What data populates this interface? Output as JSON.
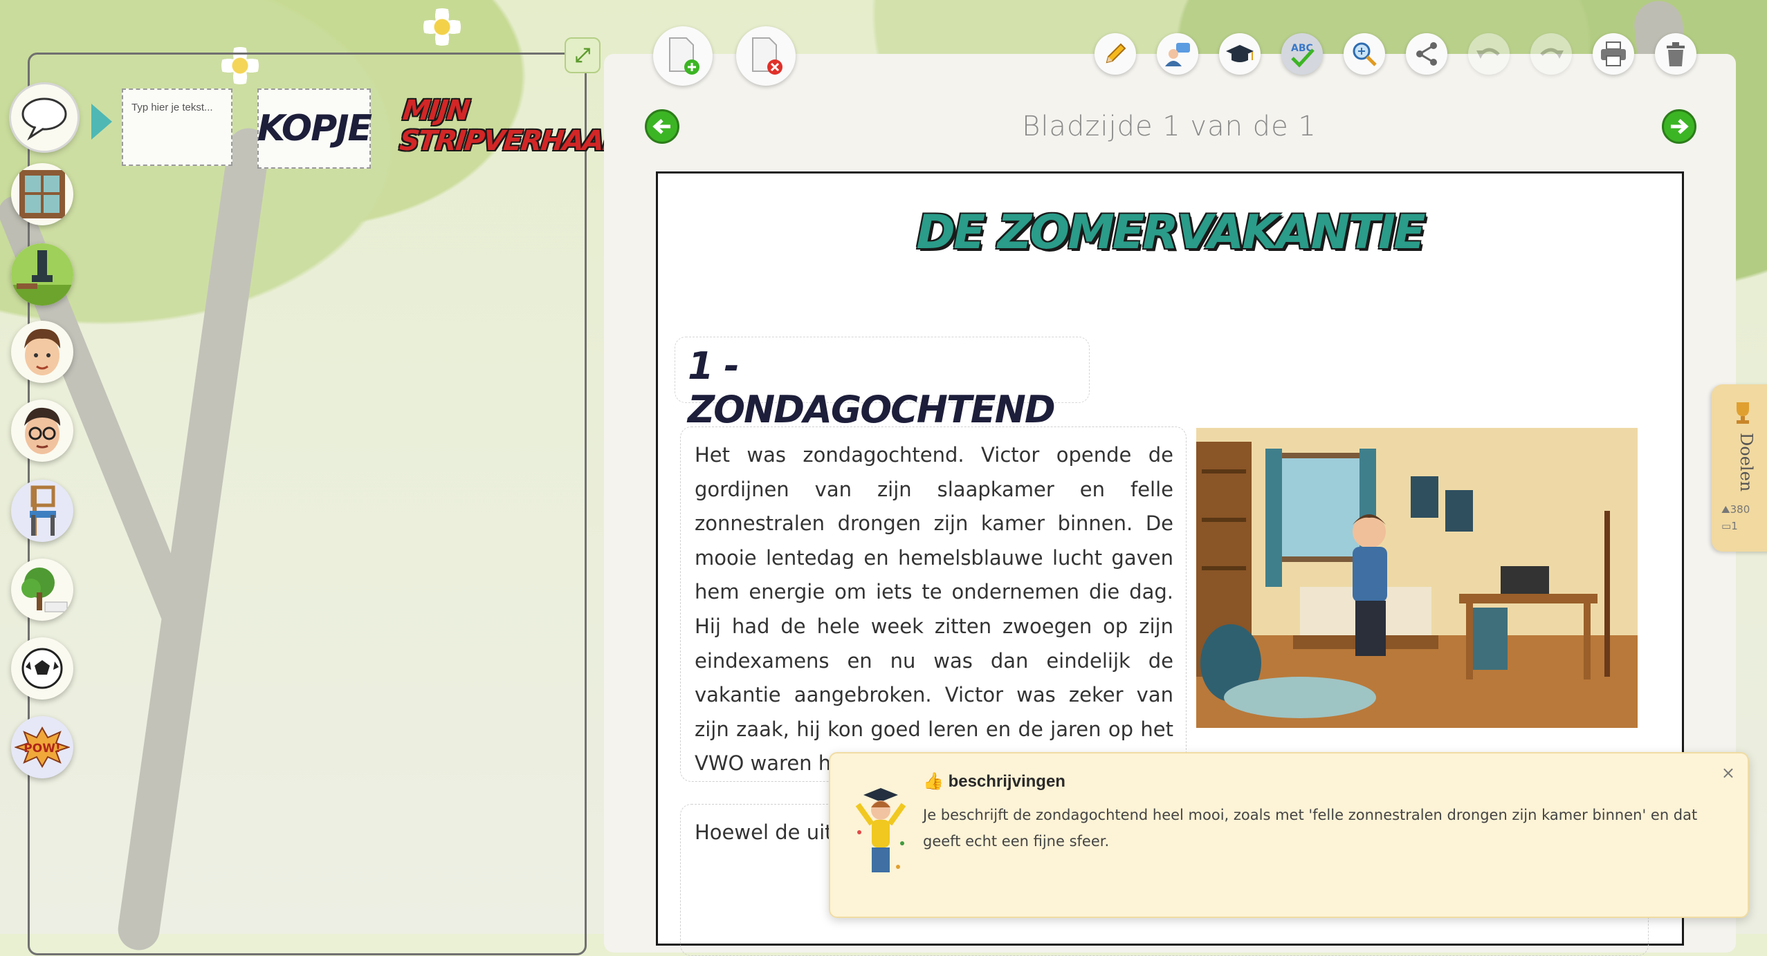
{
  "sidebar": {
    "categories": [
      {
        "name": "speech-balloons",
        "icon": "speech-balloon-icon"
      },
      {
        "name": "windows",
        "icon": "window-icon"
      },
      {
        "name": "scenery",
        "icon": "park-scene-icon"
      },
      {
        "name": "boy-character",
        "icon": "boy-face-icon"
      },
      {
        "name": "man-character",
        "icon": "man-with-glasses-icon"
      },
      {
        "name": "furniture",
        "icon": "chair-icon"
      },
      {
        "name": "nature",
        "icon": "tree-icon"
      },
      {
        "name": "objects",
        "icon": "soccer-ball-icon"
      },
      {
        "name": "effects",
        "icon": "pow-icon"
      }
    ],
    "templates": {
      "textbox_text": "Typ hier je tekst...",
      "heading_text": "KOPJE",
      "comic_title_text": "MIJN STRIPVERHAAL!"
    }
  },
  "toolbar": {
    "add_page_icon": "add-page-icon",
    "delete_page_icon": "delete-page-icon",
    "tools": [
      "pencil-icon",
      "teacher-feedback-icon",
      "graduation-cap-icon",
      "spellcheck-icon",
      "zoom-icon",
      "share-icon",
      "undo-icon",
      "redo-icon",
      "print-icon",
      "trash-icon"
    ]
  },
  "pagination": {
    "label": "Bladzijde 1 van de 1"
  },
  "document": {
    "title": "DE ZOMERVAKANTIE",
    "section_heading": "1 - ZONDAGOCHTEND",
    "paragraph1": "Het was zondagochtend. Victor opende de gordijnen van zijn slaapkamer en felle zonnestralen drongen zijn kamer binnen. De mooie lentedag en hemelsblauwe lucht gaven hem energie om iets te ondernemen die dag. Hij had de hele week zitten zwoegen op zijn eindexamens en nu was dan eindelijk de vakantie aangebroken. Victor was zeker van zijn zaak, hij kon goed leren en de jaren op het VWO waren hem ge",
    "paragraph2": "Hoewel de uit gerust hart aangedrongen"
  },
  "goals_tab": {
    "label": "Doelen",
    "words": "380",
    "pages": "1"
  },
  "toast": {
    "emoji": "👍",
    "title": "beschrijvingen",
    "body": "Je beschrijft de zondagochtend heel mooi, zoals met 'felle zonnestralen drongen zijn kamer binnen' en dat geeft echt een fijne sfeer.",
    "close": "×"
  },
  "colors": {
    "accent_green": "#3cb524",
    "title_teal": "#2a9c89",
    "toast_bg": "#fdf3d6",
    "arrow_teal": "#4fb8b4"
  }
}
